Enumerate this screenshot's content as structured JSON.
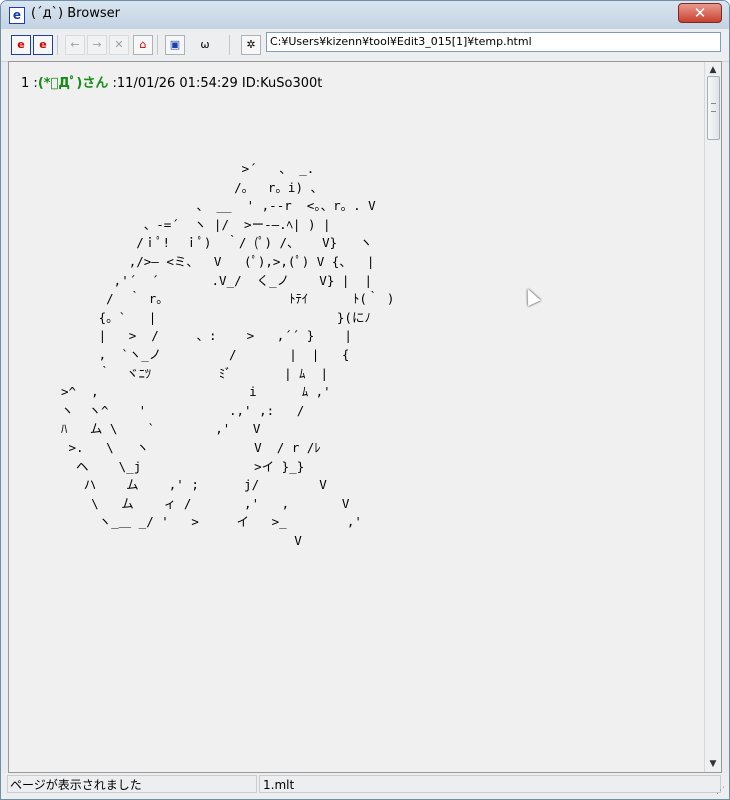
{
  "window": {
    "title": "(´д`) Browser",
    "app_icon_glyph": "e",
    "close_glyph": "✕"
  },
  "toolbar": {
    "buttons": [
      {
        "name": "ie-button-1",
        "glyph": "e"
      },
      {
        "name": "ie-button-2",
        "glyph": "e"
      },
      {
        "name": "back-button",
        "glyph": "←"
      },
      {
        "name": "forward-button",
        "glyph": "→"
      },
      {
        "name": "stop-button",
        "glyph": "✕"
      },
      {
        "name": "home-button",
        "glyph": "⌂"
      },
      {
        "name": "window-button",
        "glyph": "▣"
      },
      {
        "name": "cat-face-button",
        "glyph": "ω"
      },
      {
        "name": "bug-cat-button",
        "glyph": "✲"
      }
    ],
    "address": "C:¥Users¥kizenn¥tool¥Edit3_015[1]¥temp.html"
  },
  "post": {
    "number": "1",
    "separator": ":",
    "name": "(*ﾟДﾟ)さん",
    "meta": ":11/01/26 01:54:29 ID:KuSo300t",
    "art": "                        >´   、 _.\n                       /。　 r。i) 、\n                  、 __  ' ,--r  <。、r。. V\n           、-=´  ヽ |/  >ー-―.ﾍ| ) |\n          /ｉﾟ!  ｉﾟ)  ｀/ (ﾟ) /、   V}   ヽ\n         ,/>― <ミ、  V   (ﾟ),>,(ﾟ) V {、  |\n       ,'´  ´       .V_/  く_ノ    V} |  |\n      /  ｀ r。                ﾄﾃｲ      ﾄ(｀ )\n     {。`   |                        }(にﾉ\n     |   >  /     、:    >   ,´´ }    |\n     ,  `ヽ_ノ         /       |  |   {\n     ｀  ヾﾆﾂ         ﾐﾞ       | ﾑ  |\n>^  ,                    i      ﾑ ,'\nヽ  ヽ^    '           .,' ,:   /\nﾊ   ム \\    `        ,'   V\n >.   \\   ヽ              V  / r /ﾚ\n  ヘ    \\_j               >イ }_}\n   ハ    ム    ,' ;      j/        V\n    \\   ム    ィ /       ,'   ,       V\n     ヽ_＿ _/ '   >     イ   >_        ,'\n                               V\n"
  },
  "scrollbar": {
    "up": "▲",
    "down": "▼"
  },
  "status": {
    "left": "ページが表示されました",
    "right": "1.mlt",
    "grip": "⋰"
  }
}
